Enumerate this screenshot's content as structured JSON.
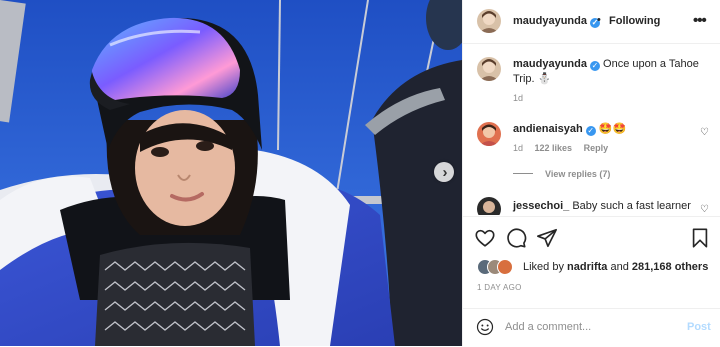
{
  "header": {
    "username": "maudyayunda",
    "separator": "•",
    "follow_label": "Following",
    "more_label": "•••"
  },
  "caption": {
    "username": "maudyayunda",
    "text": "Once upon a Tahoe Trip. ⛄",
    "time": "1d"
  },
  "comments": [
    {
      "username": "andienaisyah",
      "text": "🤩🤩",
      "time": "1d",
      "likes": "122 likes",
      "reply_label": "Reply",
      "view_replies": "View replies (7)"
    },
    {
      "username": "jessechoi_",
      "text": "Baby such a fast learner"
    }
  ],
  "likes": {
    "prefix": "Liked by",
    "first_user": "nadrifta",
    "conjunction": "and",
    "others": "281,168 others"
  },
  "date": "1 DAY AGO",
  "add_comment": {
    "placeholder": "Add a comment...",
    "post_label": "Post"
  },
  "icons": {
    "carousel_next": "chevron-right-icon",
    "like": "heart-icon",
    "comment": "comment-bubble-icon",
    "share": "paper-plane-icon",
    "save": "bookmark-icon",
    "emoji": "smiley-icon"
  },
  "colors": {
    "verified": "#3897f0",
    "post_button": "#b3dbff",
    "meta_text": "#8e8e8e"
  }
}
